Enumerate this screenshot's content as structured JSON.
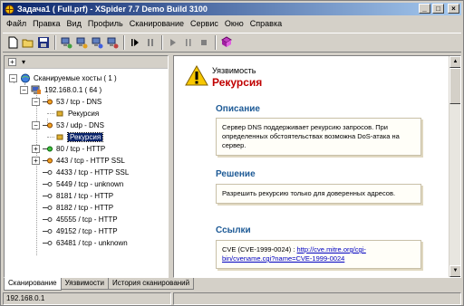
{
  "window": {
    "title": "Задача1 ( Full.prf) - XSpider 7.7 Demo Build 3100",
    "controls": [
      "_",
      "□",
      "×"
    ]
  },
  "menu": [
    "Файл",
    "Правка",
    "Вид",
    "Профиль",
    "Сканирование",
    "Сервис",
    "Окно",
    "Справка"
  ],
  "toolbar": {
    "icons": [
      "new-icon",
      "open-icon",
      "save-icon",
      "scan-icon",
      "scan-add-icon",
      "scan-host-icon",
      "scan-config-icon",
      "step-icon",
      "pause-icon",
      "play-icon",
      "step-forward-icon",
      "stop-icon",
      "book-icon"
    ]
  },
  "tree": {
    "header_plus": "⊞",
    "root": "Сканируемые хосты ( 1 )",
    "host": "192.168.0.1 ( 64 )",
    "items": [
      {
        "label": "53 / tcp - DNS",
        "expanded": true,
        "status": "orange"
      },
      {
        "label": "Рекурсия",
        "child": true
      },
      {
        "label": "53 / udp - DNS",
        "expanded": true,
        "status": "orange"
      },
      {
        "label": "Рекурсия",
        "child": true,
        "selected": true
      },
      {
        "label": "80 / tcp - HTTP",
        "status": "green"
      },
      {
        "label": "443 / tcp - HTTP SSL",
        "status": "orange"
      },
      {
        "label": "4433 / tcp - HTTP SSL",
        "status": "plain"
      },
      {
        "label": "5449 / tcp - unknown",
        "status": "plain"
      },
      {
        "label": "8181 / tcp - HTTP",
        "status": "plain"
      },
      {
        "label": "8182 / tcp - HTTP",
        "status": "plain"
      },
      {
        "label": "45555 / tcp - HTTP",
        "status": "plain"
      },
      {
        "label": "49152 / tcp - HTTP",
        "status": "plain"
      },
      {
        "label": "63481 / tcp - unknown",
        "status": "plain"
      }
    ]
  },
  "detail": {
    "kind": "Уязвимость",
    "name": "Рекурсия",
    "description_title": "Описание",
    "description": "Сервер DNS поддерживает рекурсию запросов. При определенных обстоятельствах возможна DoS-атака на сервер.",
    "solution_title": "Решение",
    "solution": "Разрешить рекурсию только для доверенных адресов.",
    "links_title": "Ссылки",
    "link_prefix": "CVE (CVE-1999-0024) : ",
    "link_text": "http://cve.mitre.org/cgi-bin/cvename.cgi?name=CVE-1999-0024"
  },
  "tabs": [
    "Сканирование",
    "Уязвимости",
    "История сканирований"
  ],
  "status": {
    "address": "192.168.0.1"
  },
  "colors": {
    "title_gradient_start": "#0a246a",
    "selected_bg": "#0a246a",
    "vuln_name": "#c00000",
    "section_title": "#1d5a96",
    "link": "#0000c0"
  }
}
